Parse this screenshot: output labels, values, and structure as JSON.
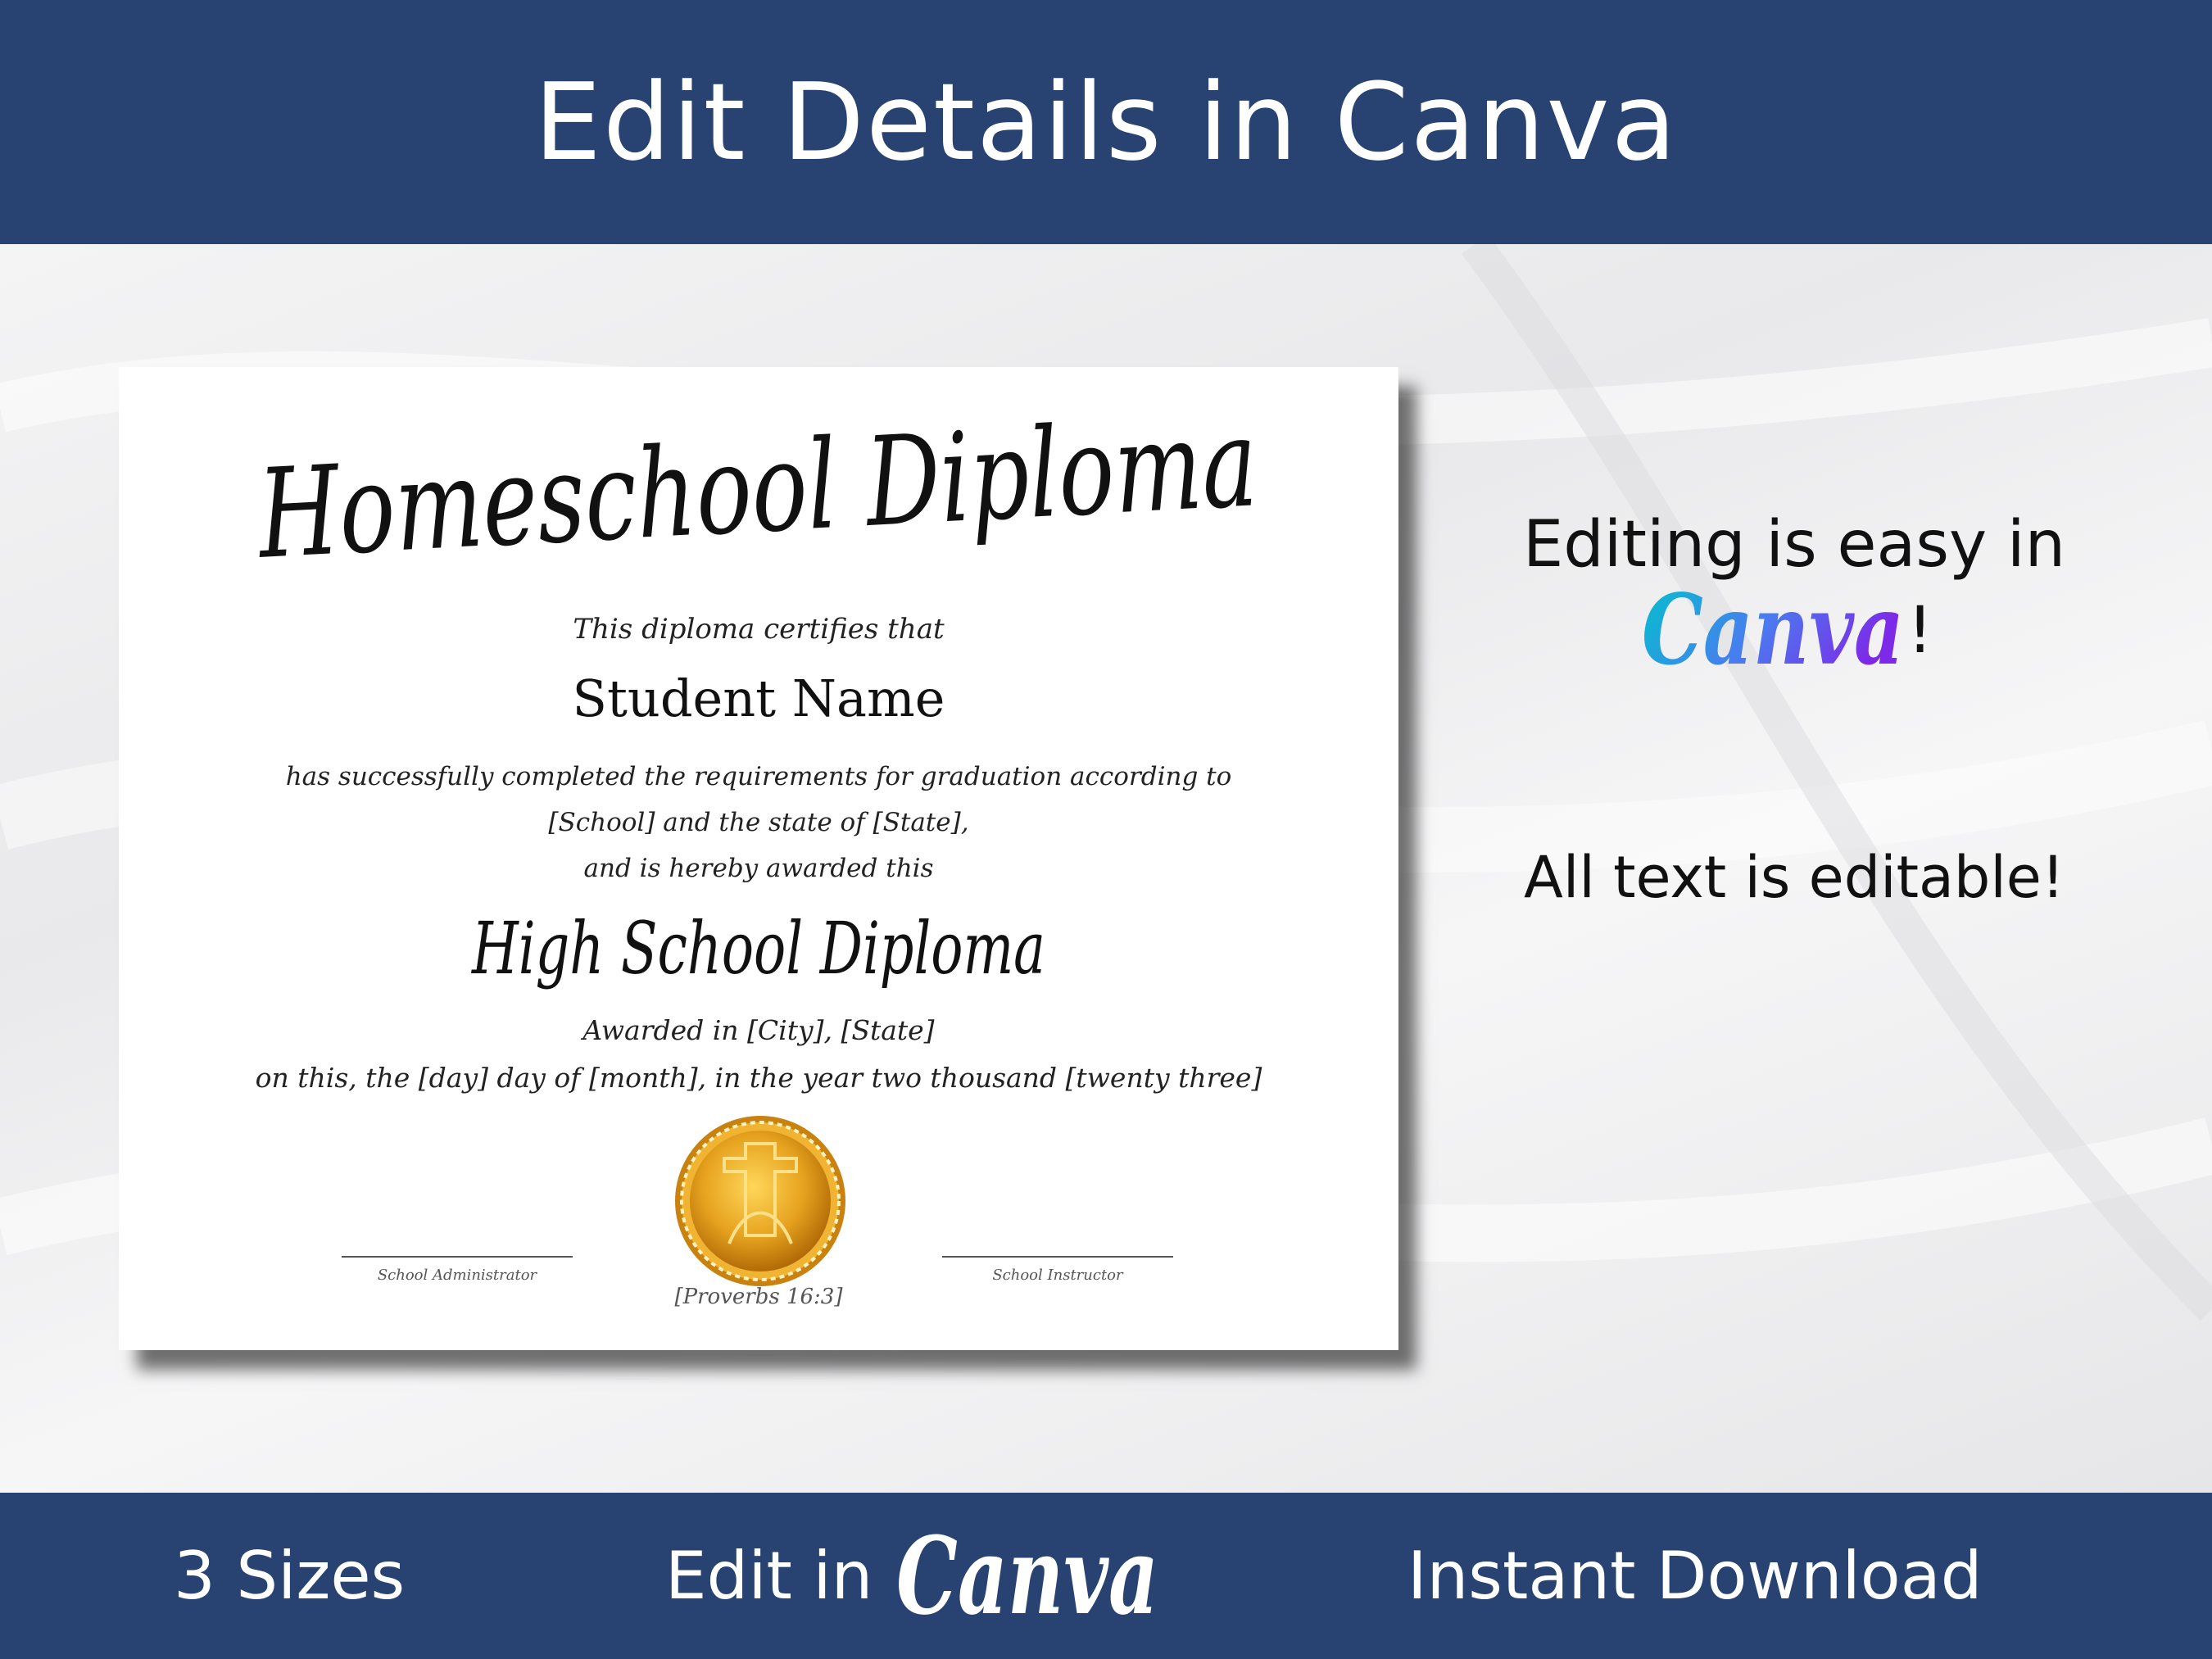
{
  "header": {
    "title": "Edit Details in Canva"
  },
  "diploma": {
    "title": "Homeschool Diploma",
    "certifies": "This diploma certifies that",
    "student_name": "Student Name",
    "body_line1": "has successfully completed the requirements for graduation according to",
    "body_line2": "[School] and the state of [State],",
    "body_line3": "and is hereby awarded this",
    "subtitle": "High School Diploma",
    "awarded_in": "Awarded in [City], [State]",
    "date_line": "on this, the [day] day of [month], in the year two thousand [twenty three]",
    "left_signature_label": "School Administrator",
    "right_signature_label": "School Instructor",
    "verse": "[Proverbs 16:3]"
  },
  "side": {
    "line1": "Editing is easy in",
    "canva_logo": "Canva",
    "exclamation": "!",
    "line2": "All text is editable!"
  },
  "footer": {
    "sizes": "3 Sizes",
    "edit_in": "Edit in",
    "canva_logo": "Canva",
    "instant_download": "Instant Download"
  },
  "colors": {
    "banner": "#284372",
    "seal_gold": "#e6a21e",
    "canva_gradient_start": "#00c4cc",
    "canva_gradient_end": "#7d2ae8"
  }
}
